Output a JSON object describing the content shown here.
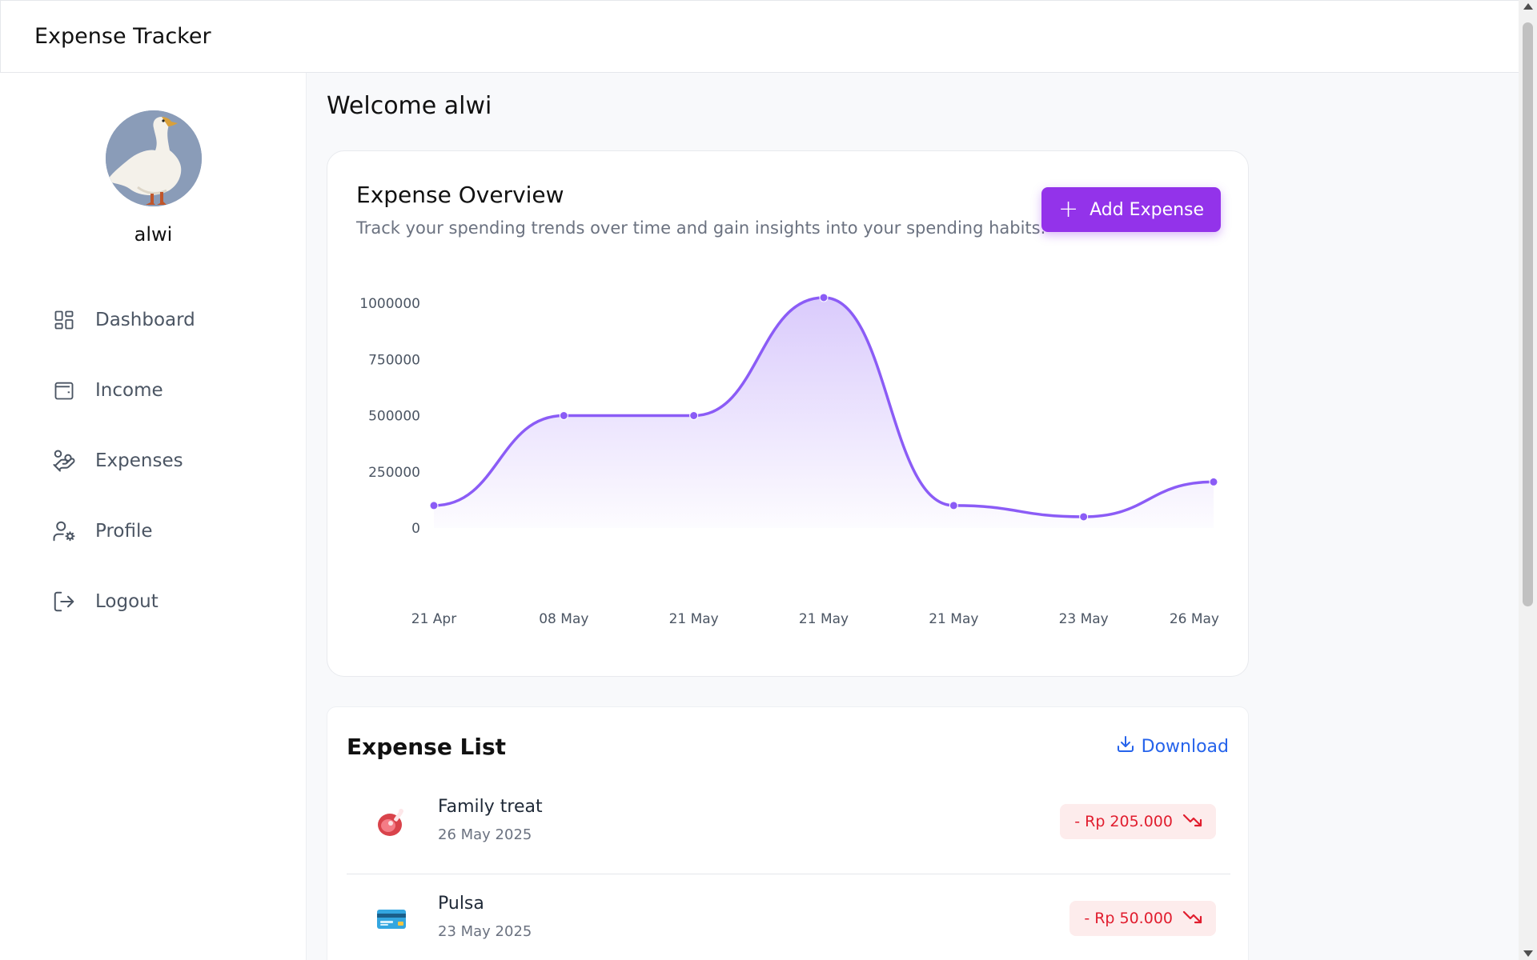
{
  "app": {
    "title": "Expense Tracker"
  },
  "sidebar": {
    "username": "alwi",
    "items": [
      {
        "label": "Dashboard",
        "icon": "dashboard-icon"
      },
      {
        "label": "Income",
        "icon": "wallet-icon"
      },
      {
        "label": "Expenses",
        "icon": "hand-coins-icon"
      },
      {
        "label": "Profile",
        "icon": "user-cog-icon"
      },
      {
        "label": "Logout",
        "icon": "logout-icon"
      }
    ]
  },
  "main": {
    "welcome": "Welcome alwi",
    "overview": {
      "title": "Expense Overview",
      "subtitle": "Track your spending trends over time and gain insights into your spending habits.",
      "add_button_label": "Add Expense"
    },
    "expense_list": {
      "title": "Expense List",
      "download_label": "Download",
      "items": [
        {
          "name": "Family treat",
          "date": "26 May 2025",
          "amount": "- Rp 205.000",
          "icon": "meat-icon"
        },
        {
          "name": "Pulsa",
          "date": "23 May 2025",
          "amount": "- Rp 50.000",
          "icon": "credit-card-icon"
        }
      ]
    }
  },
  "colors": {
    "accent": "#9333ea",
    "line": "#8b5cf6",
    "negative": "#e11d2e",
    "link": "#2563eb"
  },
  "chart_data": {
    "type": "area",
    "categories": [
      "21 Apr",
      "08 May",
      "21 May",
      "21 May",
      "21 May",
      "23 May",
      "26 May"
    ],
    "values": [
      100000,
      500000,
      500000,
      1025000,
      100000,
      50000,
      205000
    ],
    "ylim": [
      0,
      1000000
    ],
    "yticks": [
      0,
      250000,
      500000,
      750000,
      1000000
    ],
    "grid": false
  }
}
